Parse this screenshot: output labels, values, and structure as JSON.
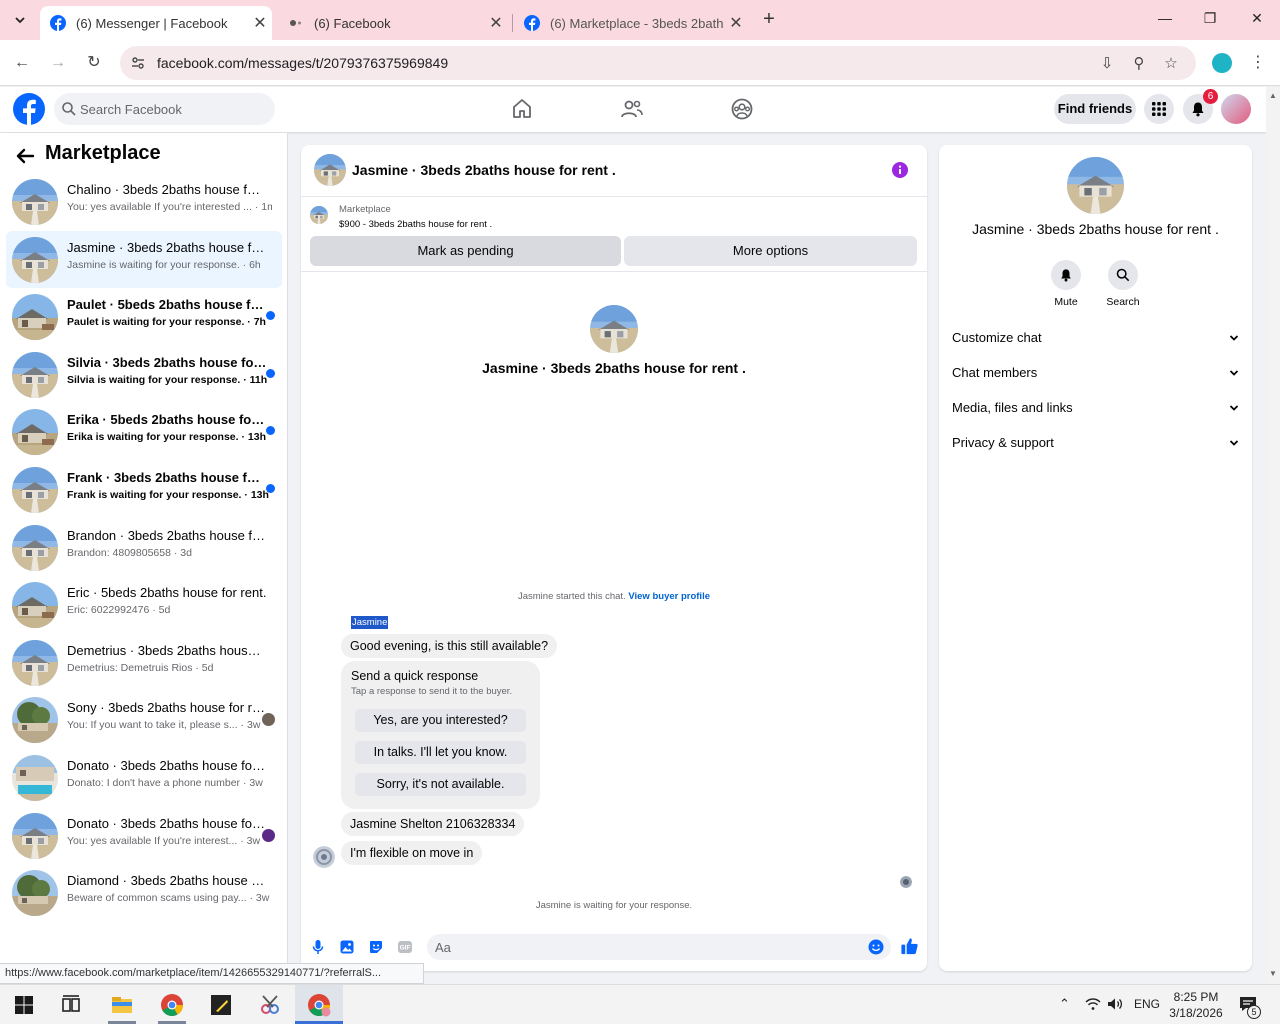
{
  "browser": {
    "tabs": [
      {
        "title": "(6) Messenger | Facebook",
        "active": true
      },
      {
        "title": "(6) Facebook",
        "active": false
      },
      {
        "title": "(6) Marketplace - 3beds 2baths",
        "active": false
      }
    ],
    "url": "facebook.com/messages/t/2079376375969849",
    "status_url": "https://www.facebook.com/marketplace/item/1426655329140771/?referralS..."
  },
  "header": {
    "search_placeholder": "Search Facebook",
    "find_friends": "Find friends",
    "notification_count": "6"
  },
  "left": {
    "title": "Marketplace",
    "chats": [
      {
        "name": "Chalino · 3beds 2baths house for rent .",
        "preview": "You: yes available If you're interested ...",
        "time": "1m",
        "unread": false,
        "selected": false,
        "thumb": "house"
      },
      {
        "name": "Jasmine · 3beds 2baths house for rent .",
        "preview": "Jasmine is waiting for your response.",
        "time": "6h",
        "unread": false,
        "selected": true,
        "thumb": "house"
      },
      {
        "name": "Paulet · 5beds 2baths house for rent.",
        "preview": "Paulet is waiting for your response.",
        "time": "7h",
        "unread": true,
        "selected": false,
        "thumb": "house5"
      },
      {
        "name": "Silvia · 3beds 2baths house for rent .",
        "preview": "Silvia is waiting for your response.",
        "time": "11h",
        "unread": true,
        "selected": false,
        "thumb": "house"
      },
      {
        "name": "Erika · 5beds 2baths house for rent.",
        "preview": "Erika is waiting for your response.",
        "time": "13h",
        "unread": true,
        "selected": false,
        "thumb": "house5"
      },
      {
        "name": "Frank · 3beds 2baths house for rent .",
        "preview": "Frank is waiting for your response.",
        "time": "13h",
        "unread": true,
        "selected": false,
        "thumb": "house"
      },
      {
        "name": "Brandon · 3beds 2baths house for rent .",
        "preview": "Brandon: 4809805658",
        "time": "3d",
        "unread": false,
        "selected": false,
        "thumb": "house"
      },
      {
        "name": "Eric · 5beds 2baths house for rent.",
        "preview": "Eric: 6022992476",
        "time": "5d",
        "unread": false,
        "selected": false,
        "thumb": "house5"
      },
      {
        "name": "Demetrius · 3beds 2baths house for rent .",
        "preview": "Demetrius: Demetruis Rios",
        "time": "5d",
        "unread": false,
        "selected": false,
        "thumb": "house"
      },
      {
        "name": "Sony · 3beds 2baths house for rent .",
        "preview": "You: If you want to take it, please s...",
        "time": "3w",
        "unread": false,
        "selected": false,
        "thumb": "tree",
        "seen": "photo"
      },
      {
        "name": "Donato · 3beds 2baths house for rent .",
        "preview": "Donato: I don't have a phone number",
        "time": "3w",
        "unread": false,
        "selected": false,
        "thumb": "pool"
      },
      {
        "name": "Donato · 3beds 2baths house for rent .",
        "preview": "You: yes available If you're interest...",
        "time": "3w",
        "unread": false,
        "selected": false,
        "thumb": "house",
        "seen": "purple"
      },
      {
        "name": "Diamond · 3beds 2baths house for rent .",
        "preview": "Beware of common scams using pay...",
        "time": "3w",
        "unread": false,
        "selected": false,
        "thumb": "tree"
      }
    ]
  },
  "conversation": {
    "title": "Jasmine · 3beds 2baths house for rent .",
    "listing_label": "Marketplace",
    "listing_price": "$900 - 3beds 2baths house for rent .",
    "mark_pending": "Mark as pending",
    "more_options": "More options",
    "intro_title": "Jasmine · 3beds 2baths house for rent .",
    "started_text": "Jasmine started this chat.",
    "buyer_profile_link": "View buyer profile",
    "sender_name": "Jasmine",
    "message1": "Good evening, is this still available?",
    "quick_title": "Send a quick response",
    "quick_sub": "Tap a response to send it to the buyer.",
    "quick_replies": [
      "Yes, are you interested?",
      "In talks. I'll let you know.",
      "Sorry, it's not available."
    ],
    "message2": "Jasmine Shelton 2106328334",
    "message3": "I'm flexible on move in",
    "waiting_text": "Jasmine is waiting for your response.",
    "composer_placeholder": "Aa"
  },
  "info": {
    "title": "Jasmine · 3beds 2baths house for rent .",
    "mute": "Mute",
    "search": "Search",
    "rows": [
      "Customize chat",
      "Chat members",
      "Media, files and links",
      "Privacy & support"
    ]
  },
  "taskbar": {
    "language": "ENG",
    "time": "8:25 PM",
    "date": "3/18/2026",
    "notification_count": "5"
  },
  "colors": {
    "tab_strip": "#fad9e1",
    "fb_blue": "#0866ff",
    "badge_red": "#e41e3f",
    "selected_chat": "#ebf5ff",
    "info_purple": "#9c27e0"
  }
}
